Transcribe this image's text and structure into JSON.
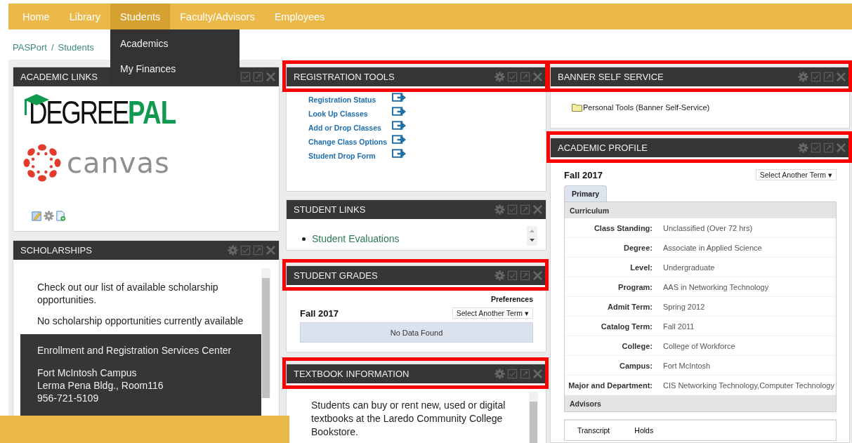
{
  "nav": {
    "items": [
      {
        "label": "Home",
        "selected": false
      },
      {
        "label": "Library",
        "selected": false
      },
      {
        "label": "Students",
        "selected": true
      },
      {
        "label": "Faculty/Advisors",
        "selected": false
      },
      {
        "label": "Employees",
        "selected": false
      }
    ]
  },
  "dropdown": {
    "items": [
      "Academics",
      "My Finances"
    ]
  },
  "breadcrumb": {
    "items": [
      "PASPort",
      "Students"
    ],
    "separator": "/"
  },
  "columns": [
    {
      "portlets": [
        {
          "kind": "logos",
          "title": "ACADEMIC LINKS",
          "highlighted": false,
          "gear": false,
          "degreepal": [
            "DEGREE",
            "PAL"
          ],
          "canvas": "canvas"
        },
        {
          "kind": "scholarships",
          "title": "SCHOLARSHIPS",
          "highlighted": false,
          "gear": true,
          "paragraphs": [
            "Check out our list of available scholarship opportunities.",
            "No scholarship opportunities currently available"
          ],
          "contact": {
            "title": "Enrollment and Registration Services Center",
            "lines": [
              "Fort McIntosh Campus",
              "Lerma Pena Bldg., Room116",
              "956-721-5109"
            ]
          }
        }
      ]
    },
    {
      "portlets": [
        {
          "kind": "links",
          "title": "REGISTRATION TOOLS",
          "highlighted": true,
          "gear": true,
          "links": [
            "Registration Status",
            "Look Up Classes",
            "Add or Drop Classes",
            "Change Class Options",
            "Student Drop Form"
          ]
        },
        {
          "kind": "bullets",
          "title": "STUDENT LINKS",
          "highlighted": false,
          "gear": true,
          "items": [
            "Student Evaluations"
          ]
        },
        {
          "kind": "grades",
          "title": "STUDENT GRADES",
          "highlighted": true,
          "gear": true,
          "preferences": "Preferences",
          "term": "Fall 2017",
          "select": "Select Another Term ▾",
          "empty": "No Data Found"
        },
        {
          "kind": "text",
          "title": "TEXTBOOK INFORMATION",
          "highlighted": true,
          "gear": true,
          "text": "Students can buy or rent new, used or digital textbooks at the Laredo Community College Bookstore."
        }
      ]
    },
    {
      "portlets": [
        {
          "kind": "folder",
          "title": "BANNER SELF SERVICE",
          "highlighted": true,
          "gear": true,
          "item": "Personal Tools (Banner Self-Service)"
        },
        {
          "kind": "profile",
          "title": "ACADEMIC PROFILE",
          "highlighted": true,
          "gear": true,
          "term": "Fall 2017",
          "select": "Select Another Term ▾",
          "tabs": [
            {
              "label": "Primary",
              "selected": true
            }
          ],
          "sections": [
            {
              "title": "Curriculum",
              "rows": [
                {
                  "label": "Class Standing:",
                  "value": "Unclassified (Over 72 hrs)"
                },
                {
                  "label": "Degree:",
                  "value": "Associate in Applied Science"
                },
                {
                  "label": "Level:",
                  "value": "Undergraduate"
                },
                {
                  "label": "Program:",
                  "value": "AAS in Networking Technology"
                },
                {
                  "label": "Admit Term:",
                  "value": "Spring 2012"
                },
                {
                  "label": "Catalog Term:",
                  "value": "Fall 2011"
                },
                {
                  "label": "College:",
                  "value": "College of Workforce"
                },
                {
                  "label": "Campus:",
                  "value": "Fort McIntosh"
                },
                {
                  "label": "Major and Department:",
                  "value": "CIS Networking Technology,Computer Technology"
                }
              ]
            },
            {
              "title": "Advisors"
            }
          ],
          "bottom_tabs": [
            "Transcript",
            "Holds"
          ]
        }
      ]
    }
  ]
}
